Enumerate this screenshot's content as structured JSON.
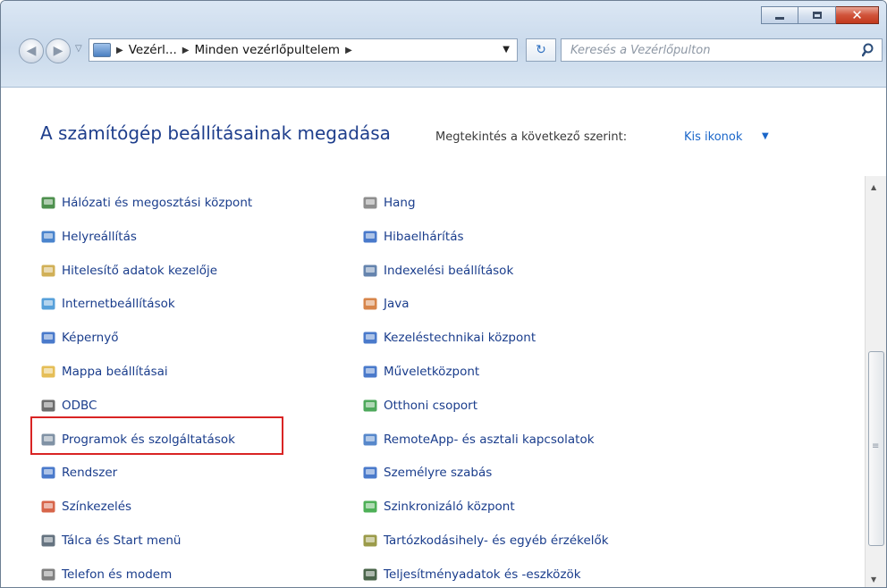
{
  "window": {
    "caption": {
      "minimize_icon": "minimize-icon",
      "maximize_icon": "maximize-icon",
      "close_glyph": "✕"
    }
  },
  "navbar": {
    "back_glyph": "◀",
    "forward_glyph": "▶",
    "history_dropdown_glyph": "▽",
    "breadcrumb": [
      "Vezérl...",
      "Minden vezérlőpultelem"
    ],
    "breadcrumb_separator": "▶",
    "address_dropdown_glyph": "▼",
    "refresh_glyph": "↻",
    "search_placeholder": "Keresés a Vezérlőpulton"
  },
  "header": {
    "title": "A számítógép beállításainak megadása",
    "view_label": "Megtekintés a következő szerint:",
    "view_value": "Kis ikonok",
    "view_caret": "▼"
  },
  "items": {
    "left": [
      {
        "label": "Hálózati és megosztási központ",
        "icon": "network-icon",
        "color": "#2f7d2f"
      },
      {
        "label": "Helyreállítás",
        "icon": "recovery-icon",
        "color": "#2a6fc4"
      },
      {
        "label": "Hitelesítő adatok kezelője",
        "icon": "credentials-icon",
        "color": "#c9a23a"
      },
      {
        "label": "Internetbeállítások",
        "icon": "internet-options-icon",
        "color": "#3a8fd4"
      },
      {
        "label": "Képernyő",
        "icon": "display-icon",
        "color": "#2a63c2"
      },
      {
        "label": "Mappa beállításai",
        "icon": "folder-options-icon",
        "color": "#e0b33a"
      },
      {
        "label": "ODBC",
        "icon": "odbc-icon",
        "color": "#555555"
      },
      {
        "label": "Programok és szolgáltatások",
        "icon": "programs-icon",
        "color": "#6a7f95"
      },
      {
        "label": "Rendszer",
        "icon": "system-icon",
        "color": "#2a63c2"
      },
      {
        "label": "Színkezelés",
        "icon": "color-management-icon",
        "color": "#d04a2a"
      },
      {
        "label": "Tálca és Start menü",
        "icon": "taskbar-icon",
        "color": "#4a5a6a"
      },
      {
        "label": "Telefon és modem",
        "icon": "phone-modem-icon",
        "color": "#6a6a6a"
      }
    ],
    "right": [
      {
        "label": "Hang",
        "icon": "sound-icon",
        "color": "#7a7a7a"
      },
      {
        "label": "Hibaelhárítás",
        "icon": "troubleshooting-icon",
        "color": "#2a63c2"
      },
      {
        "label": "Indexelési beállítások",
        "icon": "indexing-icon",
        "color": "#4a6fa0"
      },
      {
        "label": "Java",
        "icon": "java-icon",
        "color": "#d0702a"
      },
      {
        "label": "Kezeléstechnikai központ",
        "icon": "ease-of-access-icon",
        "color": "#2a63c2"
      },
      {
        "label": "Műveletközpont",
        "icon": "action-center-flag-icon",
        "color": "#2a63c2"
      },
      {
        "label": "Otthoni csoport",
        "icon": "homegroup-icon",
        "color": "#2f9a3f"
      },
      {
        "label": "RemoteApp- és asztali kapcsolatok",
        "icon": "remoteapp-icon",
        "color": "#3a73c2"
      },
      {
        "label": "Személyre szabás",
        "icon": "personalization-icon",
        "color": "#2a63c2"
      },
      {
        "label": "Szinkronizáló központ",
        "icon": "sync-center-icon",
        "color": "#2fa23a"
      },
      {
        "label": "Tartózkodásihely- és egyéb érzékelők",
        "icon": "location-sensors-icon",
        "color": "#8a8a2a"
      },
      {
        "label": "Teljesítményadatok és -eszközök",
        "icon": "performance-icon",
        "color": "#2a4a2a"
      }
    ]
  },
  "scrollbar": {
    "up_glyph": "▲",
    "down_glyph": "▼",
    "grip_glyph": "≡"
  }
}
